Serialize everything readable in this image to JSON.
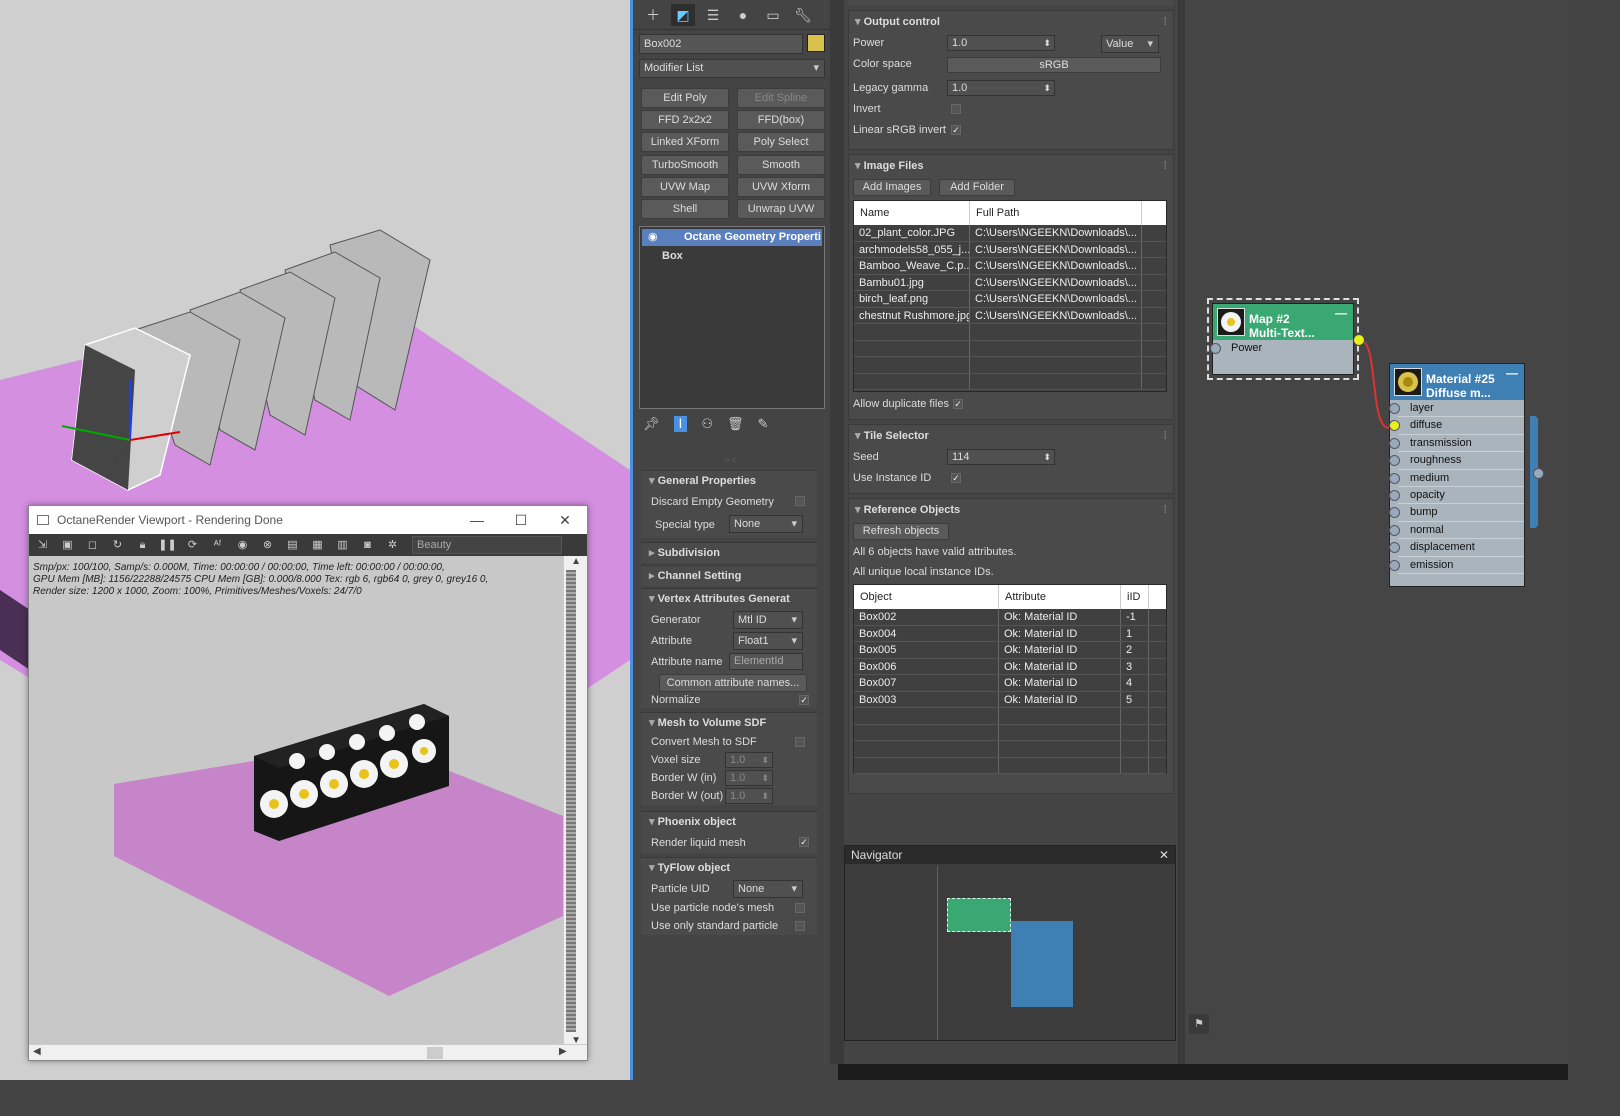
{
  "viewport_window": {
    "title": "OctaneRender Viewport - Rendering Done",
    "render_pass": "Beauty",
    "stats": [
      "Smp/px: 100/100,   Samp/s: 0.000M,   Time: 00:00:00 / 00:00:00,   Time left: 00:00:00 / 00:00:00,",
      "GPU Mem [MB]: 1156/22288/24575    CPU Mem [GB]: 0.000/8.000    Tex: rgb 6, rgb64 0, grey 0, grey16 0,",
      "Render size: 1200 x 1000,   Zoom: 100%,   Primitives/Meshes/Voxels: 24/7/0"
    ]
  },
  "command_panel": {
    "object_name": "Box002",
    "object_color": "#d8c24a",
    "modifier_list": "Modifier List",
    "modifier_buttons": [
      {
        "label": "Edit Poly",
        "enabled": true
      },
      {
        "label": "Edit Spline",
        "enabled": false
      },
      {
        "label": "FFD 2x2x2",
        "enabled": true
      },
      {
        "label": "FFD(box)",
        "enabled": true
      },
      {
        "label": "Linked XForm",
        "enabled": true
      },
      {
        "label": "Poly Select",
        "enabled": true
      },
      {
        "label": "TurboSmooth",
        "enabled": true
      },
      {
        "label": "Smooth",
        "enabled": true
      },
      {
        "label": "UVW Map",
        "enabled": true
      },
      {
        "label": "UVW Xform",
        "enabled": true
      },
      {
        "label": "Shell",
        "enabled": true
      },
      {
        "label": "Unwrap UVW",
        "enabled": true
      }
    ],
    "stack": [
      "Octane Geometry Properti",
      "Box"
    ],
    "general_properties": {
      "title": "General Properties",
      "discard_empty": "Discard Empty Geometry",
      "special_type_label": "Special type",
      "special_type_value": "None"
    },
    "subdivision": "Subdivision",
    "channel_setting": "Channel Setting",
    "vertex_attributes": {
      "title": "Vertex Attributes Generat",
      "generator_label": "Generator",
      "generator_value": "Mtl ID",
      "attribute_label": "Attribute",
      "attribute_value": "Float1",
      "attribute_name_label": "Attribute name",
      "attribute_name_value": "ElementId",
      "common_button": "Common attribute names...",
      "normalize": "Normalize"
    },
    "mesh_to_volume": {
      "title": "Mesh to Volume SDF",
      "convert": "Convert Mesh to SDF",
      "voxel_size": "Voxel size",
      "voxel_size_value": "1.0",
      "border_in": "Border W (in)",
      "border_in_value": "1.0",
      "border_out": "Border W (out)",
      "border_out_value": "1.0"
    },
    "phoenix": {
      "title": "Phoenix object",
      "render_liquid": "Render liquid mesh"
    },
    "tyflow": {
      "title": "TyFlow object",
      "particle_uid_label": "Particle UID",
      "particle_uid_value": "None",
      "use_particle_mesh": "Use particle node's mesh",
      "use_standard": "Use only standard particle"
    }
  },
  "params": {
    "output_control": {
      "title": "Output control",
      "power_label": "Power",
      "power_value": "1.0",
      "power_mode": "Value",
      "color_space_label": "Color space",
      "color_space_value": "sRGB",
      "legacy_gamma_label": "Legacy gamma",
      "legacy_gamma_value": "1.0",
      "invert_label": "Invert",
      "linear_srgb_label": "Linear sRGB invert"
    },
    "image_files": {
      "title": "Image Files",
      "add_images": "Add Images",
      "add_folder": "Add Folder",
      "col_name": "Name",
      "col_path": "Full Path",
      "rows": [
        {
          "name": "02_plant_color.JPG",
          "path": "C:\\Users\\NGEEKN\\Downloads\\..."
        },
        {
          "name": "archmodels58_055_j...",
          "path": "C:\\Users\\NGEEKN\\Downloads\\..."
        },
        {
          "name": "Bamboo_Weave_C.p...",
          "path": "C:\\Users\\NGEEKN\\Downloads\\..."
        },
        {
          "name": "Bambu01.jpg",
          "path": "C:\\Users\\NGEEKN\\Downloads\\..."
        },
        {
          "name": "birch_leaf.png",
          "path": "C:\\Users\\NGEEKN\\Downloads\\..."
        },
        {
          "name": "chestnut Rushmore.jpg",
          "path": "C:\\Users\\NGEEKN\\Downloads\\..."
        }
      ],
      "allow_duplicates": "Allow duplicate files"
    },
    "tile_selector": {
      "title": "Tile Selector",
      "seed_label": "Seed",
      "seed_value": "114",
      "use_instance_label": "Use Instance ID"
    },
    "reference_objects": {
      "title": "Reference Objects",
      "refresh": "Refresh objects",
      "msg1": "All 6 objects have valid attributes.",
      "msg2": "All unique local instance IDs.",
      "col_object": "Object",
      "col_attribute": "Attribute",
      "col_iid": "iID",
      "rows": [
        {
          "object": "Box002",
          "attribute": "Ok: Material ID",
          "iid": "-1"
        },
        {
          "object": "Box004",
          "attribute": "Ok: Material ID",
          "iid": "1"
        },
        {
          "object": "Box005",
          "attribute": "Ok: Material ID",
          "iid": "2"
        },
        {
          "object": "Box006",
          "attribute": "Ok: Material ID",
          "iid": "3"
        },
        {
          "object": "Box007",
          "attribute": "Ok: Material ID",
          "iid": "4"
        },
        {
          "object": "Box003",
          "attribute": "Ok: Material ID",
          "iid": "5"
        }
      ]
    }
  },
  "node_editor": {
    "map_node": {
      "title1": "Map #2",
      "title2": "Multi-Text...",
      "slot": "Power"
    },
    "material_node": {
      "title1": "Material #25",
      "title2": "Diffuse m...",
      "slots": [
        "layer",
        "diffuse",
        "transmission",
        "roughness",
        "medium",
        "opacity",
        "bump",
        "normal",
        "displacement",
        "emission"
      ]
    },
    "navigator_title": "Navigator"
  }
}
